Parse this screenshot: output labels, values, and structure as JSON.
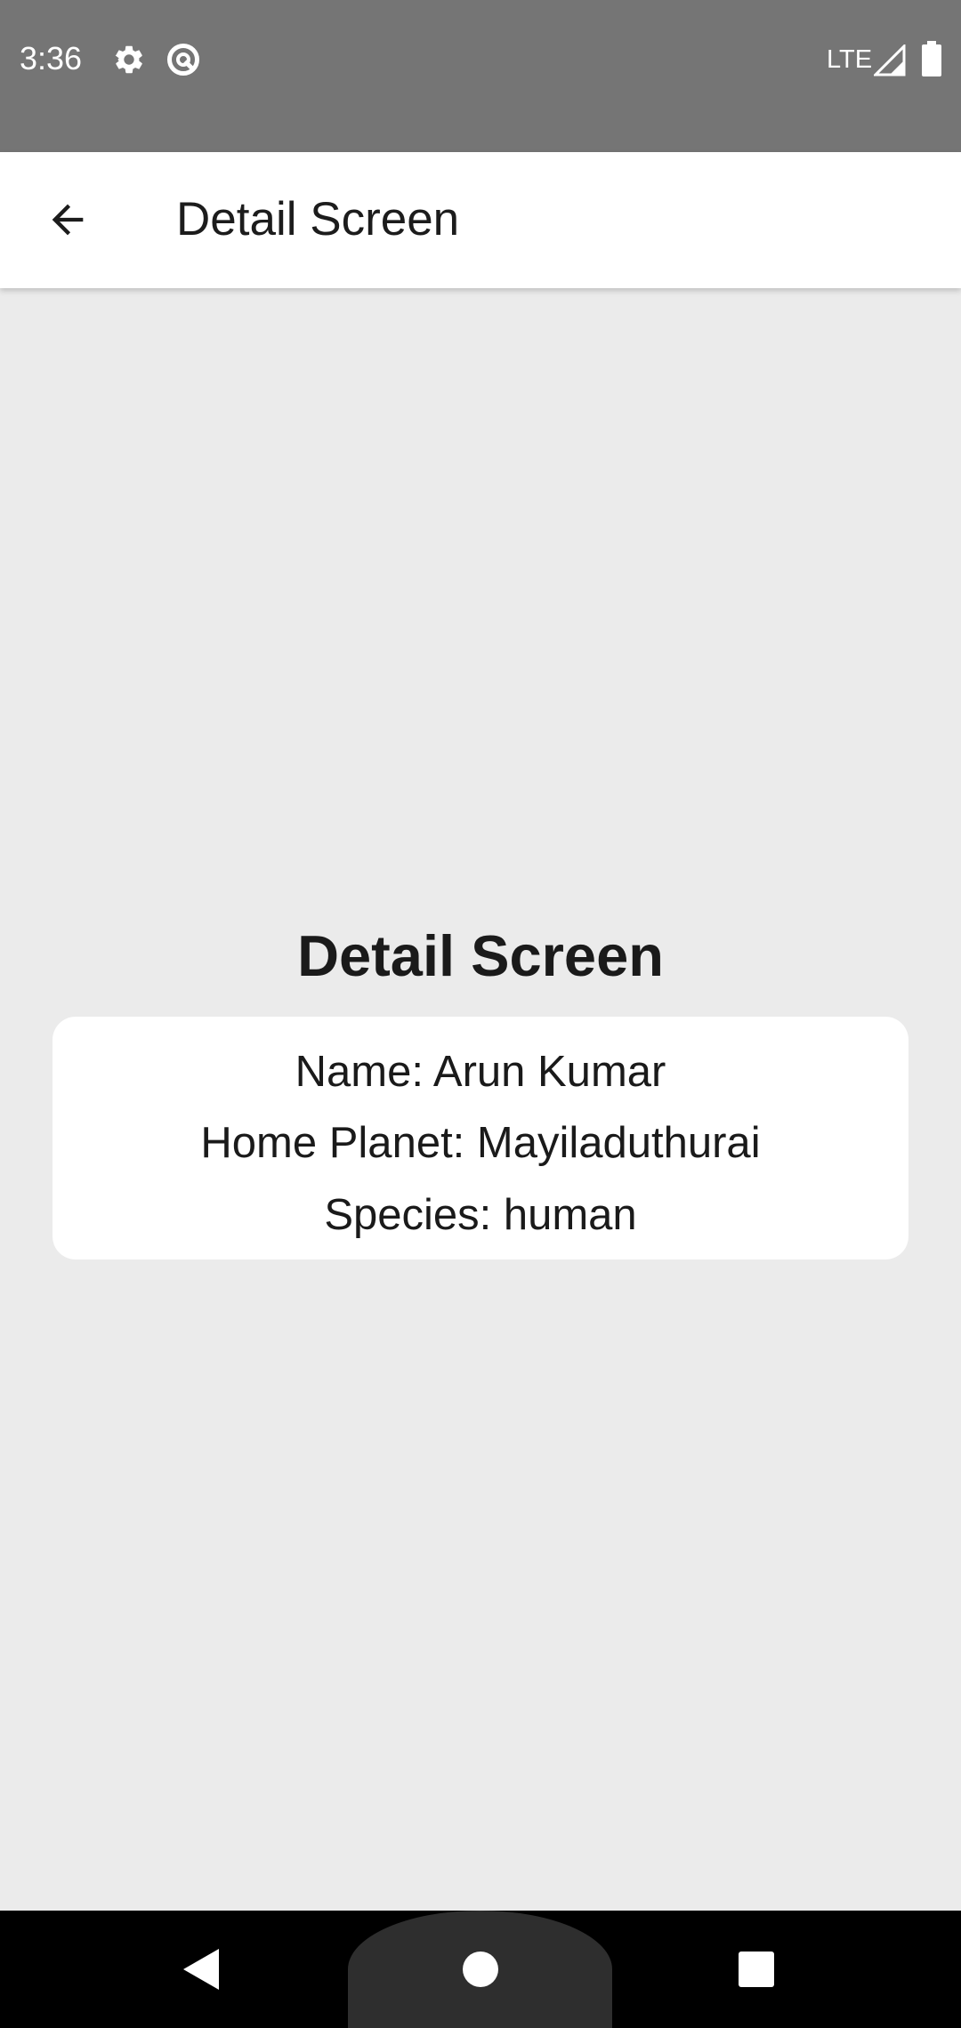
{
  "status_bar": {
    "time": "3:36",
    "network": "LTE",
    "icons": [
      "settings-icon",
      "vpn-icon",
      "signal-icon",
      "battery-icon"
    ]
  },
  "app_bar": {
    "title": "Detail Screen",
    "back_icon": "arrow-back-icon"
  },
  "content": {
    "heading": "Detail Screen",
    "details": {
      "name": "Name: Arun Kumar",
      "home_planet": "Home Planet: Mayiladuthurai",
      "species": "Species: human"
    }
  },
  "nav_bar": {
    "icons": [
      "nav-back-icon",
      "nav-home-icon",
      "nav-recents-icon"
    ]
  },
  "colors": {
    "status_bar": "#757575",
    "app_bar": "#ffffff",
    "background": "#ebebeb",
    "card": "#ffffff",
    "nav_bar": "#000000"
  }
}
